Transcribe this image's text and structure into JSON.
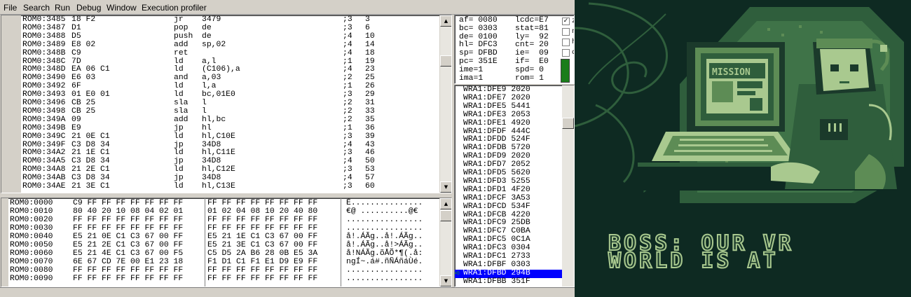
{
  "menu": [
    "File",
    "Search",
    "Run",
    "Debug",
    "Window",
    "Execution profiler"
  ],
  "disassembly": [
    {
      "addr": "ROM0:3485",
      "bytes": "18 F2",
      "op": "jr",
      "args": "3479",
      "cyc": ";3",
      "tot": "3"
    },
    {
      "addr": "ROM0:3487",
      "bytes": "D1",
      "op": "pop",
      "args": "de",
      "cyc": ";3",
      "tot": "6"
    },
    {
      "addr": "ROM0:3488",
      "bytes": "D5",
      "op": "push",
      "args": "de",
      "cyc": ";4",
      "tot": "10"
    },
    {
      "addr": "ROM0:3489",
      "bytes": "E8 02",
      "op": "add",
      "args": "sp,02",
      "cyc": ";4",
      "tot": "14"
    },
    {
      "addr": "ROM0:348B",
      "bytes": "C9",
      "op": "ret",
      "args": "",
      "cyc": ";4",
      "tot": "18"
    },
    {
      "addr": "ROM0:348C",
      "bytes": "7D",
      "op": "ld",
      "args": "a,l",
      "cyc": ";1",
      "tot": "19"
    },
    {
      "addr": "ROM0:348D",
      "bytes": "EA 06 C1",
      "op": "ld",
      "args": "(C106),a",
      "cyc": ";4",
      "tot": "23"
    },
    {
      "addr": "ROM0:3490",
      "bytes": "E6 03",
      "op": "and",
      "args": "a,03",
      "cyc": ";2",
      "tot": "25"
    },
    {
      "addr": "ROM0:3492",
      "bytes": "6F",
      "op": "ld",
      "args": "l,a",
      "cyc": ";1",
      "tot": "26"
    },
    {
      "addr": "ROM0:3493",
      "bytes": "01 E0 01",
      "op": "ld",
      "args": "bc,01E0",
      "cyc": ";3",
      "tot": "29"
    },
    {
      "addr": "ROM0:3496",
      "bytes": "CB 25",
      "op": "sla",
      "args": "l",
      "cyc": ";2",
      "tot": "31"
    },
    {
      "addr": "ROM0:3498",
      "bytes": "CB 25",
      "op": "sla",
      "args": "l",
      "cyc": ";2",
      "tot": "33"
    },
    {
      "addr": "ROM0:349A",
      "bytes": "09",
      "op": "add",
      "args": "hl,bc",
      "cyc": ";2",
      "tot": "35"
    },
    {
      "addr": "ROM0:349B",
      "bytes": "E9",
      "op": "jp",
      "args": "hl",
      "cyc": ";1",
      "tot": "36"
    },
    {
      "addr": "ROM0:349C",
      "bytes": "21 0E C1",
      "op": "ld",
      "args": "hl,C10E",
      "cyc": ";3",
      "tot": "39"
    },
    {
      "addr": "ROM0:349F",
      "bytes": "C3 D8 34",
      "op": "jp",
      "args": "34D8",
      "cyc": ";4",
      "tot": "43"
    },
    {
      "addr": "ROM0:34A2",
      "bytes": "21 1E C1",
      "op": "ld",
      "args": "hl,C11E",
      "cyc": ";3",
      "tot": "46"
    },
    {
      "addr": "ROM0:34A5",
      "bytes": "C3 D8 34",
      "op": "jp",
      "args": "34D8",
      "cyc": ";4",
      "tot": "50"
    },
    {
      "addr": "ROM0:34A8",
      "bytes": "21 2E C1",
      "op": "ld",
      "args": "hl,C12E",
      "cyc": ";3",
      "tot": "53"
    },
    {
      "addr": "ROM0:34AB",
      "bytes": "C3 D8 34",
      "op": "jp",
      "args": "34D8",
      "cyc": ";4",
      "tot": "57"
    },
    {
      "addr": "ROM0:34AE",
      "bytes": "21 3E C1",
      "op": "ld",
      "args": "hl,C13E",
      "cyc": ";3",
      "tot": "60"
    }
  ],
  "registers": {
    "left": [
      "af= 0080",
      "bc= 0303",
      "de= 0100",
      "hl= DFC3",
      "sp= DFBD",
      "pc= 351E",
      "ime=1",
      "ima=1"
    ],
    "right": [
      "lcdc=E7",
      "stat=81",
      "ly=  92",
      "cnt= 20",
      "ie=  09",
      "if=  E0",
      "spd= 0",
      "rom= 1"
    ],
    "flags": [
      {
        "name": "z",
        "checked": true
      },
      {
        "name": "n",
        "checked": false
      },
      {
        "name": "h",
        "checked": false
      },
      {
        "name": "c",
        "checked": false
      }
    ],
    "checkmark": "✓"
  },
  "stack": [
    "WRA1:DFE9 2020",
    "WRA1:DFE7 2020",
    "WRA1:DFE5 5441",
    "WRA1:DFE3 2053",
    "WRA1:DFE1 4920",
    "WRA1:DFDF 444C",
    "WRA1:DFDD 524F",
    "WRA1:DFDB 5720",
    "WRA1:DFD9 2020",
    "WRA1:DFD7 2052",
    "WRA1:DFD5 5620",
    "WRA1:DFD3 5255",
    "WRA1:DFD1 4F20",
    "WRA1:DFCF 3A53",
    "WRA1:DFCD 534F",
    "WRA1:DFCB 4220",
    "WRA1:DFC9 25DB",
    "WRA1:DFC7 C0BA",
    "WRA1:DFC5 0C1A",
    "WRA1:DFC3 0304",
    "WRA1:DFC1 2733",
    "WRA1:DFBF 0303",
    "WRA1:DFBD 294B",
    "WRA1:DFBB 351F"
  ],
  "stack_selected": "WRA1:DFBD 294B",
  "hex": [
    {
      "addr": "ROM0:0000",
      "a": "C9 FF FF FF FF FF FF FF",
      "b": "FF FF FF FF FF FF FF FF",
      "ascii": "É..............."
    },
    {
      "addr": "ROM0:0010",
      "a": "80 40 20 10 08 04 02 01",
      "b": "01 02 04 08 10 20 40 80",
      "ascii": "€@ ..........@€"
    },
    {
      "addr": "ROM0:0020",
      "a": "FF FF FF FF FF FF FF FF",
      "b": "FF FF FF FF FF FF FF FF",
      "ascii": "................"
    },
    {
      "addr": "ROM0:0030",
      "a": "FF FF FF FF FF FF FF FF",
      "b": "FF FF FF FF FF FF FF FF",
      "ascii": "................"
    },
    {
      "addr": "ROM0:0040",
      "a": "E5 21 0E C1 C3 67 00 FF",
      "b": "E5 21 1E C1 C3 67 00 FF",
      "ascii": "å!.ÁÃg..å!.ÁÃg.."
    },
    {
      "addr": "ROM0:0050",
      "a": "E5 21 2E C1 C3 67 00 FF",
      "b": "E5 21 3E C1 C3 67 00 FF",
      "ascii": "å!.ÁÃg..å!>ÁÃg.."
    },
    {
      "addr": "ROM0:0060",
      "a": "E5 21 4E C1 C3 67 00 F5",
      "b": "C5 D5 2A B6 28 0B E5 3A",
      "ascii": "å!NÁÃg.õÅÕ*¶(.å:"
    },
    {
      "addr": "ROM0:0070",
      "a": "6E 67 CD 7E 00 E1 23 18",
      "b": "F1 D1 C1 F1 E1 D9 E9 FF",
      "ascii": "ngÍ~.á#.ñÑÁñáÙé."
    },
    {
      "addr": "ROM0:0080",
      "a": "FF FF FF FF FF FF FF FF",
      "b": "FF FF FF FF FF FF FF FF",
      "ascii": "................"
    },
    {
      "addr": "ROM0:0090",
      "a": "FF FF FF FF FF FF FF FF",
      "b": "FF FF FF FF FF FF FF FF",
      "ascii": "................"
    }
  ],
  "game": {
    "dialog_line1": "BOSS: OUR VR",
    "dialog_line2": "WORLD IS AT",
    "screen_text": "MISSION",
    "palette": {
      "darkest": "#0e2a22",
      "dark": "#2f5e3c",
      "mid": "#5d8c55",
      "light": "#a9c98f"
    }
  },
  "icons": {
    "scroll_up": "▲",
    "scroll_down": "▼",
    "pc_arrow": "➪"
  }
}
